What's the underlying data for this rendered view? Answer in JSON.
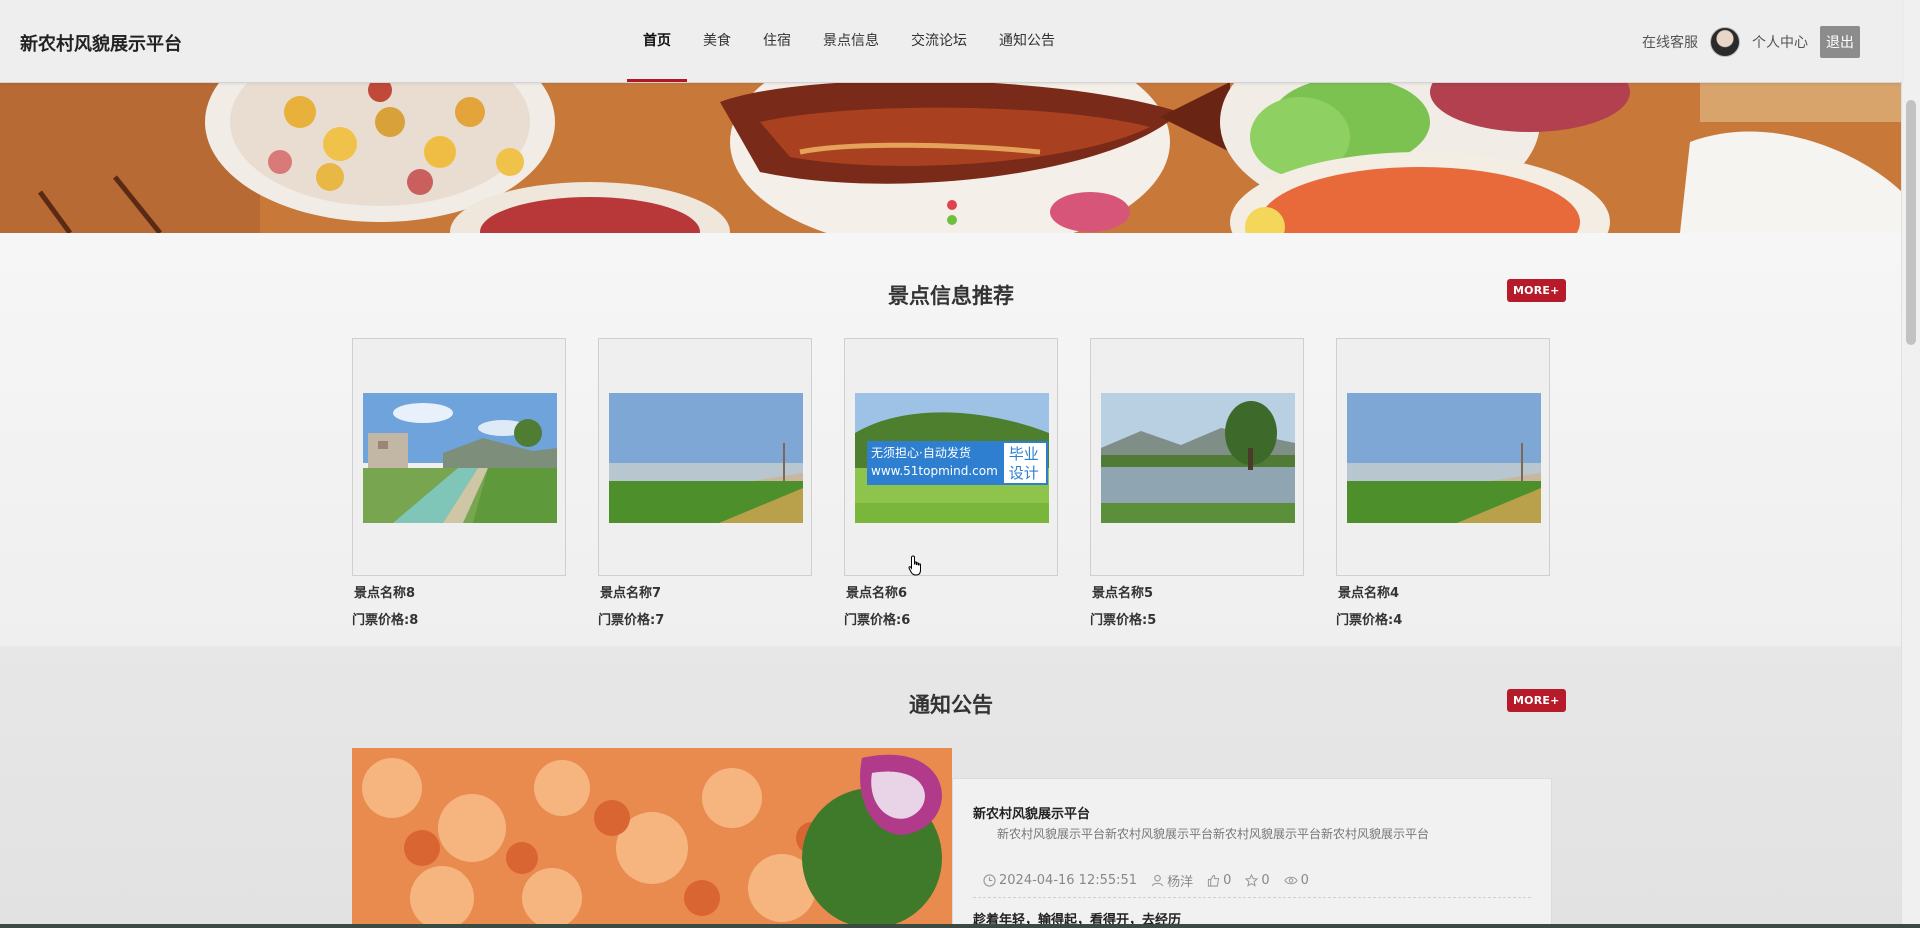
{
  "header": {
    "site_title": "新农村风貌展示平台",
    "nav": [
      {
        "label": "首页",
        "active": true
      },
      {
        "label": "美食",
        "active": false
      },
      {
        "label": "住宿",
        "active": false
      },
      {
        "label": "景点信息",
        "active": false
      },
      {
        "label": "交流论坛",
        "active": false
      },
      {
        "label": "通知公告",
        "active": false
      }
    ],
    "online_service": "在线客服",
    "profile": "个人中心",
    "logout": "退出"
  },
  "banner": {
    "image": "food-illustration",
    "active_dot": 0
  },
  "scenic": {
    "title": "景点信息推荐",
    "more": "MORE+",
    "items": [
      {
        "name": "景点名称8",
        "price": "门票价格:8",
        "image": "canal-village"
      },
      {
        "name": "景点名称7",
        "price": "门票价格:7",
        "image": "green-field"
      },
      {
        "name": "景点名称6",
        "price": "门票价格:6",
        "image": "hill-meadow"
      },
      {
        "name": "景点名称5",
        "price": "门票价格:5",
        "image": "pond-tree"
      },
      {
        "name": "景点名称4",
        "price": "门票价格:4",
        "image": "green-field"
      }
    ],
    "watermark_left": "无须担心·自动发货",
    "watermark_url": "www.51topmind.com",
    "watermark_right": "毕业设计"
  },
  "notice": {
    "title": "通知公告",
    "more": "MORE+",
    "image": "fried-shrimp",
    "items": [
      {
        "title": "新农村风貌展示平台",
        "body": "新农村风貌展示平台新农村风貌展示平台新农村风貌展示平台新农村风貌展示平台",
        "time": "2024-04-16 12:55:51",
        "author": "杨洋",
        "likes": "0",
        "favorites": "0",
        "views": "0"
      },
      {
        "title": "趁着年轻，输得起，看得开，去经历"
      }
    ]
  },
  "colors": {
    "accent": "#b71b2a",
    "nav_active": "#b01623",
    "watermark_blue": "#2f7fd1"
  }
}
